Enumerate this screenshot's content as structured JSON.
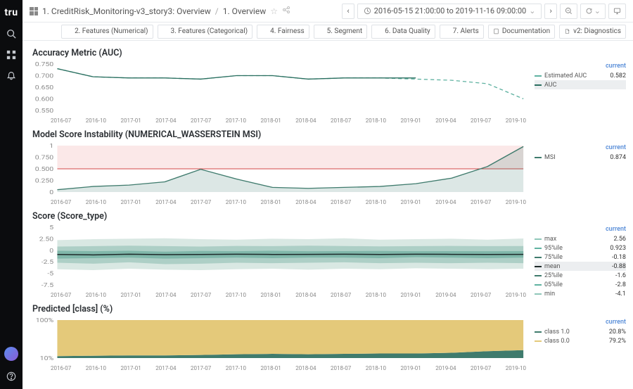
{
  "sidebar": {
    "logo": "tru"
  },
  "breadcrumb": {
    "item1": "1. CreditRisk_Monitoring-v3_story3: Overview",
    "item2": "1. Overview"
  },
  "time_range": "2016-05-15 21:00:00 to 2019-11-16 09:00:00",
  "tabs": {
    "t2": "2. Features (Numerical)",
    "t3": "3. Features (Categorical)",
    "t4": "4. Fairness",
    "t5": "5. Segment",
    "t6": "6. Data Quality",
    "t7": "7. Alerts",
    "doc": "Documentation",
    "diag": "v2: Diagnostics"
  },
  "dates": [
    "2016-07",
    "2016-10",
    "2017-01",
    "2017-04",
    "2017-07",
    "2017-10",
    "2018-01",
    "2018-04",
    "2018-07",
    "2018-10",
    "2019-01",
    "2019-04",
    "2019-07",
    "2019-10"
  ],
  "current_label": "current",
  "chart_data": [
    {
      "type": "line",
      "title": "Accuracy Metric (AUC)",
      "ylim": [
        0.55,
        0.75
      ],
      "yticks": [
        "0.750",
        "0.700",
        "0.650",
        "0.600",
        "0.550"
      ],
      "series": [
        {
          "name": "Estimated AUC",
          "color": "#5fb2a1",
          "dash": true,
          "values": [
            0.73,
            0.695,
            0.69,
            0.69,
            0.685,
            0.7,
            0.7,
            0.685,
            0.69,
            0.69,
            0.685,
            0.68,
            0.665,
            0.6
          ]
        },
        {
          "name": "AUC",
          "color": "#2b6f60",
          "dash": false,
          "values": [
            0.73,
            0.695,
            0.69,
            0.69,
            0.685,
            0.7,
            0.7,
            0.685,
            0.69,
            0.69,
            0.69,
            null,
            null,
            null
          ]
        }
      ],
      "legend": [
        {
          "name": "Estimated AUC",
          "value": "0.582",
          "color": "#5fb2a1",
          "selected": false
        },
        {
          "name": "AUC",
          "value": "",
          "color": "#2b6f60",
          "selected": true
        }
      ]
    },
    {
      "type": "line",
      "title": "Model Score Instability (NUMERICAL_WASSERSTEIN MSI)",
      "ylim": [
        0,
        1
      ],
      "yticks": [
        "1",
        "0.750",
        "0.500",
        "0.250",
        "0"
      ],
      "threshold": 0.5,
      "band": [
        0.5,
        1.0
      ],
      "series": [
        {
          "name": "MSI",
          "color": "#3f7b6d",
          "dash": false,
          "values": [
            0.05,
            0.12,
            0.15,
            0.22,
            0.49,
            0.28,
            0.1,
            0.08,
            0.1,
            0.12,
            0.18,
            0.3,
            0.55,
            0.98
          ]
        }
      ],
      "legend": [
        {
          "name": "MSI",
          "value": "0.874",
          "color": "#3f7b6d",
          "selected": false
        }
      ]
    },
    {
      "type": "area",
      "title": "Score (Score_type)",
      "ylim": [
        -7.5,
        5
      ],
      "yticks": [
        "5",
        "2.50",
        "0",
        "-2.5",
        "-5",
        "-7.5"
      ],
      "percentile_bands": [
        {
          "lo": [
            -4.1,
            -4.3,
            -4.0,
            -4.2,
            -4.3,
            -4.1,
            -4.0,
            -4.2,
            -4.0,
            -4.1,
            -3.9,
            -4.0,
            -4.1,
            -4.0
          ],
          "hi": [
            2.2,
            2.4,
            2.5,
            2.6,
            2.4,
            2.3,
            2.5,
            2.4,
            2.6,
            2.3,
            2.4,
            2.5,
            2.3,
            2.56
          ],
          "fill": "#d5e5e0"
        },
        {
          "lo": [
            -2.7,
            -2.9,
            -2.6,
            -3.0,
            -2.9,
            -2.7,
            -2.8,
            -2.7,
            -2.6,
            -2.8,
            -2.7,
            -2.8,
            -2.7,
            -2.8
          ],
          "hi": [
            0.8,
            0.9,
            1.0,
            0.9,
            0.8,
            0.95,
            0.9,
            1.0,
            0.92,
            0.85,
            0.9,
            0.95,
            0.9,
            0.923
          ],
          "fill": "#a7ccc2"
        },
        {
          "lo": [
            -1.8,
            -1.7,
            -1.6,
            -1.8,
            -1.7,
            -1.6,
            -1.7,
            -1.6,
            -1.6,
            -1.7,
            -1.5,
            -1.6,
            -1.7,
            -1.6
          ],
          "hi": [
            -0.1,
            -0.2,
            -0.1,
            -0.3,
            -0.15,
            -0.2,
            -0.1,
            -0.2,
            -0.18,
            -0.15,
            -0.2,
            -0.18,
            -0.2,
            -0.18
          ],
          "fill": "#7bb4a6"
        }
      ],
      "mean": {
        "color": "#1f2a2a",
        "values": [
          -0.9,
          -1.0,
          -0.85,
          -0.95,
          -0.9,
          -0.85,
          -0.9,
          -0.88,
          -0.85,
          -0.9,
          -0.85,
          -0.88,
          -0.9,
          -0.88
        ]
      },
      "legend": [
        {
          "name": "max",
          "value": "2.56",
          "color": "#8fc7b9"
        },
        {
          "name": "95%ile",
          "value": "0.923",
          "color": "#5fb2a1"
        },
        {
          "name": "75%ile",
          "value": "-0.18",
          "color": "#3f7b6d"
        },
        {
          "name": "mean",
          "value": "-0.88",
          "color": "#1f2a2a",
          "selected": true
        },
        {
          "name": "25%ile",
          "value": "-1.6",
          "color": "#3f7b6d"
        },
        {
          "name": "05%ile",
          "value": "-2.8",
          "color": "#5fb2a1"
        },
        {
          "name": "min",
          "value": "-4.1",
          "color": "#8fc7b9"
        }
      ]
    },
    {
      "type": "area",
      "title": "Predicted [class] (%)",
      "ylim": [
        0,
        100
      ],
      "yticks": [
        "100%",
        "10%"
      ],
      "stack": [
        {
          "name": "class 0.0",
          "fill": "#e4c97a",
          "values": [
            95,
            94,
            93,
            93,
            92,
            90,
            89,
            90,
            89,
            88,
            88,
            86,
            82,
            79.2
          ]
        },
        {
          "name": "class 1.0",
          "fill": "#3f7b6d",
          "values": [
            5,
            6,
            7,
            7,
            8,
            10,
            11,
            10,
            11,
            12,
            12,
            14,
            18,
            20.8
          ]
        }
      ],
      "legend": [
        {
          "name": "class 1.0",
          "value": "20.8%",
          "color": "#3f7b6d"
        },
        {
          "name": "class 0.0",
          "value": "79.2%",
          "color": "#e4c97a"
        }
      ]
    }
  ]
}
